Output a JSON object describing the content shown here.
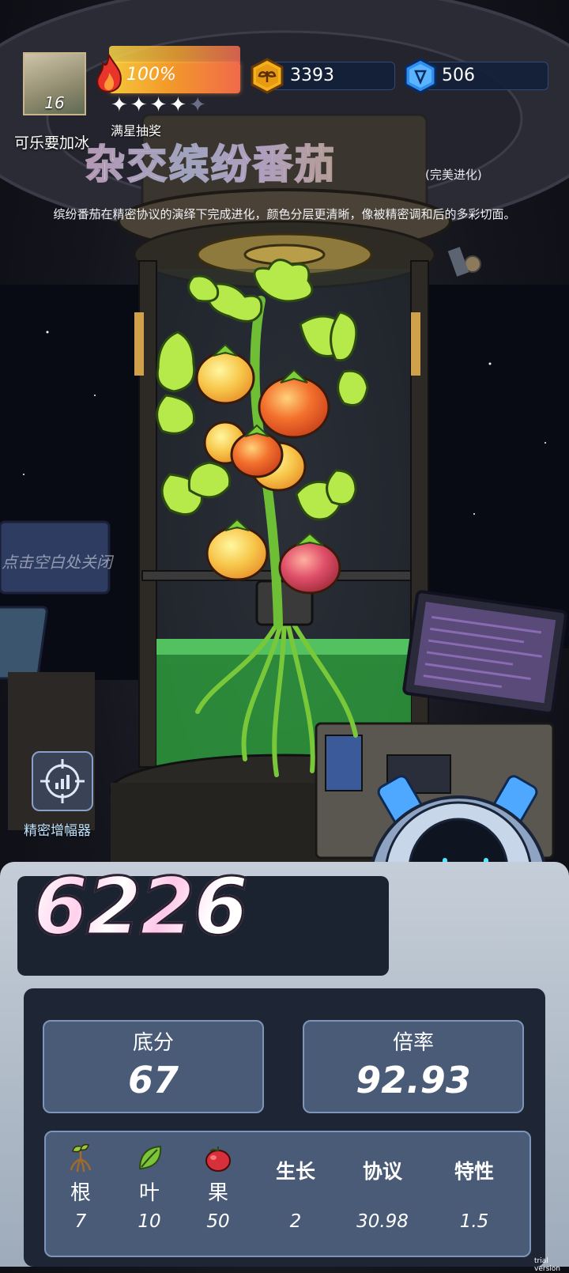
{
  "player": {
    "level": "16",
    "nickname": "可乐要加冰",
    "energy_percent": "100%",
    "stars_filled": 4,
    "stars_total": 5,
    "lottery_label": "满星抽奖"
  },
  "currency": {
    "coins": "3393",
    "gems": "506"
  },
  "plant": {
    "name": "杂交缤纷番茄",
    "tag": "(完美进化)",
    "description": "缤纷番茄在精密协议的演绎下完成进化，颜色分层更清晰，像被精密调和后的多彩切面。"
  },
  "hint": {
    "close": "点击空白处关闭"
  },
  "amplifier": {
    "label": "精密增幅器"
  },
  "result": {
    "total_score": "6226",
    "base_label": "底分",
    "base_value": "67",
    "rate_label": "倍率",
    "rate_value": "92.93"
  },
  "attributes": [
    {
      "name": "根",
      "value": "7",
      "icon": "root-icon"
    },
    {
      "name": "叶",
      "value": "10",
      "icon": "leaf-icon"
    },
    {
      "name": "果",
      "value": "50",
      "icon": "fruit-icon"
    },
    {
      "name": "生长",
      "value": "2"
    },
    {
      "name": "协议",
      "value": "30.98"
    },
    {
      "name": "特性",
      "value": "1.5"
    }
  ],
  "watermark": "trial version",
  "colors": {
    "panel_blue": "#4a5b78",
    "panel_dark": "#1e2636",
    "energy_start": "#f5c83a",
    "energy_end": "#f06a4a",
    "coin_gold": "#f2b21c",
    "gem_blue": "#2f8ff0",
    "robot_blue": "#4fa8ff"
  }
}
